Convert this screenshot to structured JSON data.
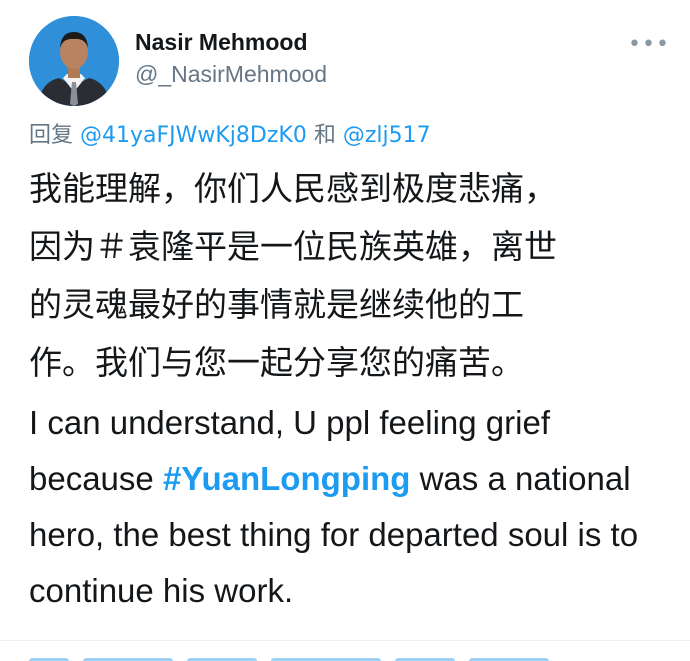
{
  "author": {
    "name": "Nasir Mehmood",
    "handle": "@_NasirMehmood",
    "avatar_icon": "user-avatar-photo"
  },
  "more_icon": "more-options-icon",
  "reply_context": {
    "prefix": "回复 ",
    "mention1": "@41yaFJWwKj8DzK0",
    "joiner": " 和 ",
    "mention2": "@zlj517"
  },
  "tweet": {
    "text_cn_lines": [
      "我能理解，你们人民感到极度悲痛，",
      "因为＃袁隆平是一位民族英雄，离世",
      "的灵魂最好的事情就是继续他的工",
      "作。我们与您一起分享您的痛苦。"
    ],
    "text_en_before": "I can understand, U ppl feeling  grief because ",
    "hashtag": "#YuanLongping",
    "text_en_after": " was a national hero, the best thing for departed soul is to continue his work."
  },
  "colors": {
    "link": "#1d9bf0",
    "secondary_text": "#657786",
    "avatar_bg": "#2f8fd8"
  }
}
